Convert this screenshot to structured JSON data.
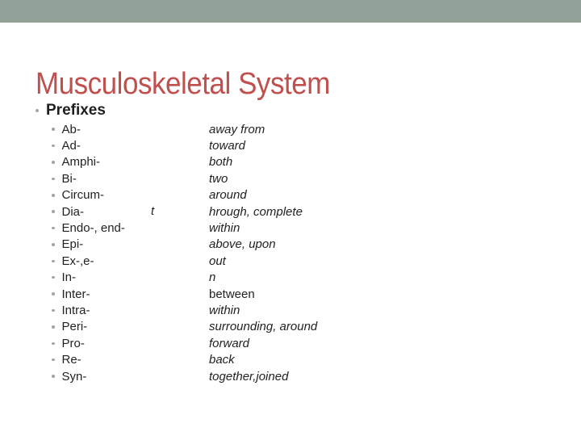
{
  "slide": {
    "title": "Musculoskeletal System",
    "colors": {
      "top_band": "#93a299",
      "title": "#c0504d",
      "text": "#222222",
      "bullet": "#a5a5a5"
    },
    "section_label": "Prefixes",
    "stray_char": "t",
    "prefixes": [
      {
        "prefix": "Ab-",
        "meaning": "away from",
        "italic": true
      },
      {
        "prefix": "Ad-",
        "meaning": "toward",
        "italic": true
      },
      {
        "prefix": "Amphi-",
        "meaning": "both",
        "italic": true
      },
      {
        "prefix": "Bi-",
        "meaning": "two",
        "italic": true
      },
      {
        "prefix": "Circum-",
        "meaning": "around",
        "italic": true
      },
      {
        "prefix": "Dia-",
        "meaning": "hrough, complete",
        "italic": true
      },
      {
        "prefix": "Endo-, end-",
        "meaning": "within",
        "italic": true
      },
      {
        "prefix": "Epi-",
        "meaning": "above, upon",
        "italic": true
      },
      {
        "prefix": "Ex-,e-",
        "meaning": "out",
        "italic": true
      },
      {
        "prefix": "In-",
        "meaning": "n",
        "italic": true
      },
      {
        "prefix": "Inter-",
        "meaning": "between",
        "italic": false
      },
      {
        "prefix": "Intra-",
        "meaning": "within",
        "italic": true
      },
      {
        "prefix": "Peri-",
        "meaning": "surrounding, around",
        "italic": true
      },
      {
        "prefix": "Pro-",
        "meaning": "forward",
        "italic": true
      },
      {
        "prefix": "Re-",
        "meaning": "back",
        "italic": true
      },
      {
        "prefix": "Syn-",
        "meaning": "together,joined",
        "italic": true
      }
    ]
  }
}
